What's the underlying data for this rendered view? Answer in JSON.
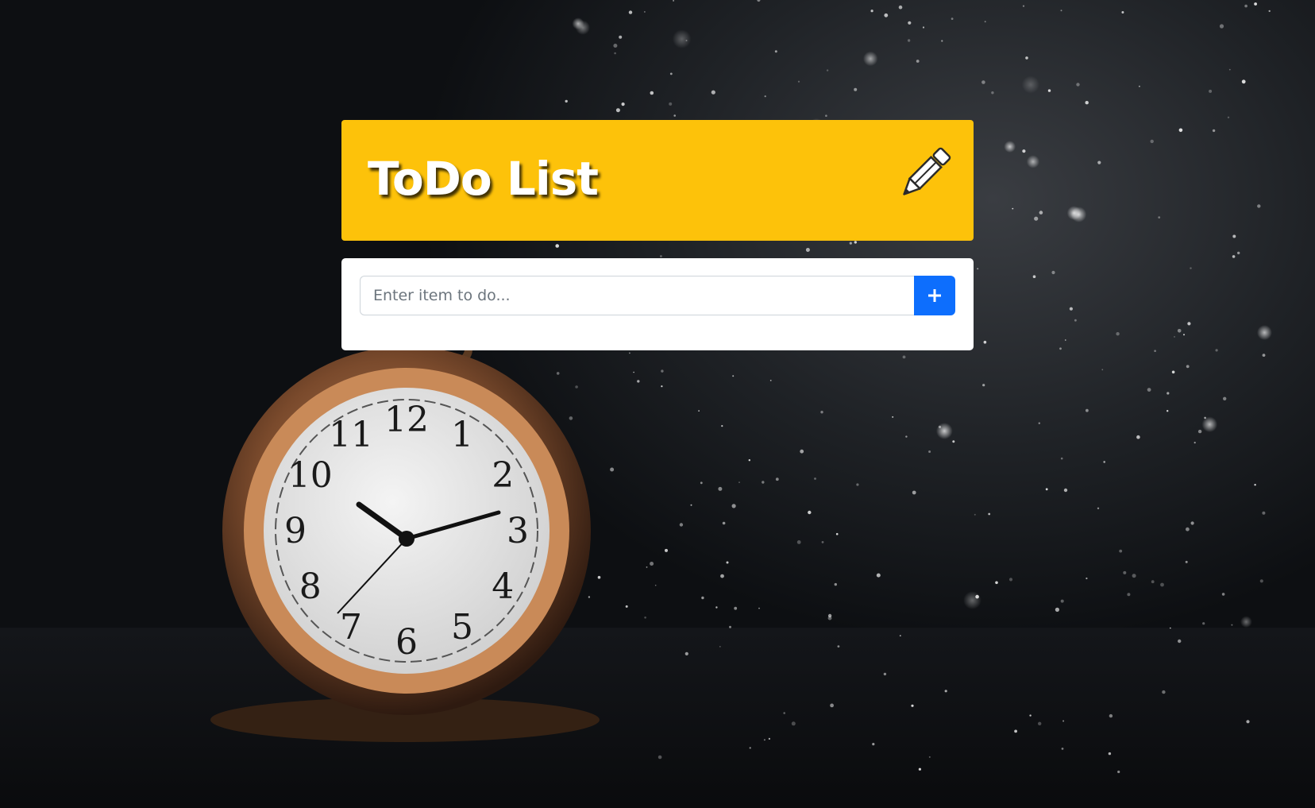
{
  "header": {
    "title": "ToDo List",
    "icon": "pencil-icon",
    "background_color": "#fdc20a"
  },
  "todo_form": {
    "input_placeholder": "Enter item to do...",
    "input_value": "",
    "add_button_icon": "plus-icon",
    "add_button_color": "#0d6efd"
  },
  "background": {
    "clock_numerals": [
      "12",
      "1",
      "2",
      "3",
      "4",
      "5",
      "6",
      "7",
      "8",
      "9",
      "10",
      "11"
    ]
  }
}
